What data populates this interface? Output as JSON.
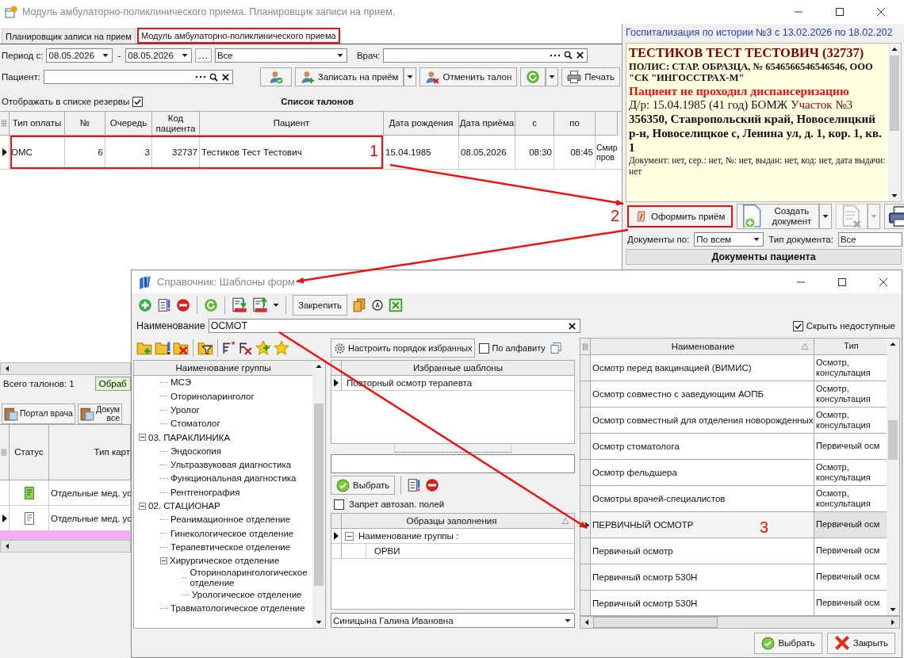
{
  "window": {
    "title": "Модуль амбулаторно-поликлинического приема. Планировщик записи на прием."
  },
  "tabs": [
    {
      "label": "Планировщик записи на прием",
      "selected": false,
      "highlighted": false
    },
    {
      "label": "Модуль амбулаторно-поликлинического приема",
      "selected": true,
      "highlighted": true
    }
  ],
  "filters": {
    "period_label": "Период с:",
    "date_from": "08.05.2026",
    "separator": "-",
    "date_to": "08.05.2026",
    "more": "...",
    "status": "Все",
    "doctor_label": "Врач:",
    "patient_label": "Пациент:"
  },
  "actions": [
    {
      "label": "Записать на приём",
      "kind": "book"
    },
    {
      "label": "Отменить талон",
      "kind": "cancel"
    }
  ],
  "print": "Печать",
  "reserve": {
    "label": "Отображать в списке резервы",
    "checked": true
  },
  "tickets": {
    "title": "Список талонов",
    "columns": [
      "Тип оплаты",
      "№",
      "Очередь",
      "Код пациента",
      "Пациент",
      "Дата рождения",
      "Дата приёма",
      "с",
      "по"
    ],
    "rows": [
      {
        "cells": [
          "ОМС",
          "6",
          "3",
          "32737",
          "Тестиков Тест Тестович",
          "15.04.1985",
          "08.05.2026",
          "08:30",
          "08:45"
        ],
        "column_10": [
          "Смир",
          "пров"
        ],
        "selected": true,
        "highlighted": true
      }
    ],
    "total": "Всего талонов: 1",
    "status_chip": "Обраб"
  },
  "portal_buttons": [
    {
      "lines": [
        "Портал врача"
      ]
    },
    {
      "lines": [
        "Докум",
        "все"
      ]
    }
  ],
  "cards": {
    "columns": [
      "Статус",
      "Тип карт"
    ],
    "rows": [
      {
        "kind": "filled",
        "text": "Отдельные мед. ус",
        "color": "#ffffff",
        "selected": false
      },
      {
        "kind": "outline",
        "text": "Отдельные мед. ус",
        "color": "#ffffff",
        "selected": true
      },
      {
        "color": "#f7aaf7",
        "selected": false
      }
    ]
  },
  "hospitalization": "Госпитализация по истории №3 с 13.02.2026 по 18.02.202",
  "patient_card": {
    "name": "ТЕСТИКОВ ТЕСТ ТЕСТОВИЧ (32737)",
    "policy": "ПОЛИС: СТАР. ОБРАЗЦА, № 6546566546546546, ООО \"СК \"ИНГОССТРАХ-М\"",
    "warning": "Пациент не проходил диспансеризацию",
    "birth": "Д/р: 15.04.1985 (41 год) БОМЖ",
    "district": "Участок №3",
    "address": "356350, Ставропольский край, Новоселицкий р-н, Новоселицкое с, Ленина ул, д. 1, кор. 1, кв. 1",
    "document": "Документ: нет, сер.: нет, №: нет, выдан: нет, код: нет, дата выдачи: нет"
  },
  "visit_button": {
    "label": "Оформить приём",
    "highlighted": true
  },
  "create_document": {
    "label": "Создать документ",
    "disabled": false
  },
  "delete_document": {
    "disabled": true
  },
  "doc_filter": {
    "by_label": "Документы по:",
    "by_value": "По всем",
    "type_label": "Тип документа:",
    "type_value": "Все"
  },
  "documents_title": "Документы пациента",
  "dialog": {
    "title": "Справочник: Шаблоны форм",
    "pin": "Закрепить",
    "name_label": "Наименование",
    "name_value": "ОСМОТ",
    "hide_unavailable": {
      "label": "Скрыть недоступные",
      "checked": true
    },
    "tree_header": "Наименование группы",
    "tree_leading": [
      "МСЭ",
      "Оториноларинголог",
      "Уролог",
      "Стоматолог"
    ],
    "tree": [
      {
        "label": "03. ПАРАКЛИНИКА",
        "expanded": true,
        "children": [
          {
            "label": "Эндоскопия"
          },
          {
            "label": "Ультразвуковая диагностика"
          },
          {
            "label": "Функциональная диагностика"
          },
          {
            "label": "Рентгенография"
          }
        ]
      },
      {
        "label": "02. СТАЦИОНАР",
        "expanded": true,
        "children": [
          {
            "label": "Реанимационное отделение"
          },
          {
            "label": "Гинекологическое отделение"
          },
          {
            "label": "Терапевтическое отделение"
          },
          {
            "label": "Хирургическое отделение",
            "expanded": true,
            "children": [
              {
                "label": "Оториноларингологическое отделение"
              },
              {
                "label": "Урологическое отделение"
              }
            ]
          },
          {
            "label": "Травматологическое отделение"
          }
        ]
      }
    ],
    "favorites_order": "Настроить порядок избранных",
    "alphabetical": {
      "label": "По алфавиту",
      "checked": false
    },
    "favorites_header": "Избранные шаблоны",
    "favorites": [
      {
        "label": "Повторный осмотр терапевта",
        "selected": true
      }
    ],
    "choose": "Выбрать",
    "autofill_lock": {
      "label": "Запрет автозап. полей",
      "checked": false
    },
    "samples_header": "Образцы заполнения",
    "samples_group": {
      "label": "Наименование группы :",
      "expanded": true,
      "selected": true,
      "children": [
        "ОРВИ"
      ]
    },
    "doctor": "Синицына Галина Ивановна",
    "templates": {
      "columns": [
        "Наименование",
        "Тип"
      ],
      "rows": [
        {
          "name": "Осмотр перед вакцинацией (ВИМИС)",
          "type": "Осмотр, консультация",
          "selected": false
        },
        {
          "name": "Осмотр совместно с заведующим АОПБ",
          "type": "Осмотр, консультация",
          "selected": false
        },
        {
          "name": "Осмотр совместный для отделения новорожденных",
          "type": "Осмотр, консультация",
          "selected": false
        },
        {
          "name": "Осмотр стоматолога",
          "type": "Первичный осм",
          "selected": false
        },
        {
          "name": "Осмотр фельдшера",
          "type": "Осмотр, консультация",
          "selected": false
        },
        {
          "name": "Осмотры врачей-специалистов",
          "type": "Осмотр, консультация",
          "selected": false
        },
        {
          "name": "ПЕРВИЧНЫЙ ОСМОТР",
          "type": "Первичный осм",
          "selected": true
        },
        {
          "name": "Первичный осмотр",
          "type": "Первичный осм",
          "selected": false
        },
        {
          "name": "Первичный осмотр 530Н",
          "type": "Первичный осм",
          "selected": false
        },
        {
          "name": "Первичный осмотр 530Н",
          "type": "Первичный осм",
          "selected": false
        }
      ]
    },
    "footer": [
      {
        "kind": "ok",
        "label": "Выбрать"
      },
      {
        "kind": "close",
        "label": "Закрыть"
      }
    ]
  },
  "annotations": [
    {
      "label": "1"
    },
    {
      "label": "2"
    },
    {
      "label": "3"
    }
  ]
}
